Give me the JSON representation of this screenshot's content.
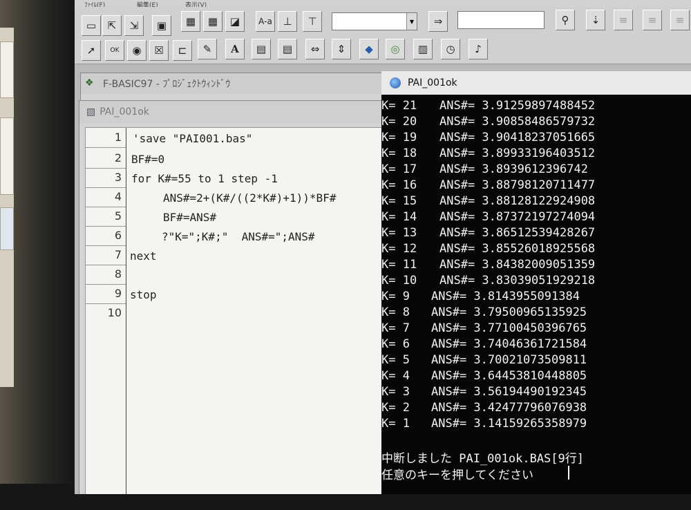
{
  "menubar": {
    "file": "ﾌｧｲﾙ(F)",
    "edit": "編集(E)",
    "view": "表示(V)"
  },
  "project_window": {
    "title": "F-BASIC97 - ﾌﾟﾛｼﾞｪｸﾄｳｨﾝﾄﾞｳ"
  },
  "editor_window": {
    "title": "PAI_001ok",
    "line_numbers": [
      "1",
      "2",
      "3",
      "4",
      "5",
      "6",
      "7",
      "8",
      "9",
      "10"
    ],
    "lines": [
      "'save \"PAI001.bas\"",
      "BF#=0",
      "for K#=55 to 1 step -1",
      "ANS#=2+(K#/((2*K#)+1))*BF#",
      "BF#=ANS#",
      "?\"K=\";K#;\"  ANS#=\";ANS#",
      "next",
      "",
      "stop",
      ""
    ]
  },
  "output_window": {
    "title": "PAI_001ok",
    "rows": [
      {
        "k": "K= 21",
        "ans": "ANS#= 3.91259897488452"
      },
      {
        "k": "K= 20",
        "ans": "ANS#= 3.90858486579732"
      },
      {
        "k": "K= 19",
        "ans": "ANS#= 3.90418237051665"
      },
      {
        "k": "K= 18",
        "ans": "ANS#= 3.89933196403512"
      },
      {
        "k": "K= 17",
        "ans": "ANS#= 3.8939612396742"
      },
      {
        "k": "K= 16",
        "ans": "ANS#= 3.88798120711477"
      },
      {
        "k": "K= 15",
        "ans": "ANS#= 3.88128122924908"
      },
      {
        "k": "K= 14",
        "ans": "ANS#= 3.87372197274094"
      },
      {
        "k": "K= 13",
        "ans": "ANS#= 3.86512539428267"
      },
      {
        "k": "K= 12",
        "ans": "ANS#= 3.85526018925568"
      },
      {
        "k": "K= 11",
        "ans": "ANS#= 3.84382009051359"
      },
      {
        "k": "K= 10",
        "ans": "ANS#= 3.83039051929218"
      },
      {
        "k": "K= 9",
        "ans": "ANS#= 3.8143955091384"
      },
      {
        "k": "K= 8",
        "ans": "ANS#= 3.79500965135925"
      },
      {
        "k": "K= 7",
        "ans": "ANS#= 3.77100450396765"
      },
      {
        "k": "K= 6",
        "ans": "ANS#= 3.74046361721584"
      },
      {
        "k": "K= 5",
        "ans": "ANS#= 3.70021073509811"
      },
      {
        "k": "K= 4",
        "ans": "ANS#= 3.64453810448805"
      },
      {
        "k": "K= 3",
        "ans": "ANS#= 3.56194490192345"
      },
      {
        "k": "K= 2",
        "ans": "ANS#= 3.42477796076938"
      },
      {
        "k": "K= 1",
        "ans": "ANS#= 3.14159265358979"
      }
    ],
    "interrupt_message": "中断しました PAI_001ok.BAS[9行]",
    "prompt_message": "任意のキーを押してください"
  },
  "icons": [
    "new-file-icon",
    "open-file-icon",
    "save-file-icon",
    "run-icon",
    "pointer-icon",
    "ok-button-icon",
    "radio-icon",
    "checkbox-icon",
    "text-tool-icon",
    "label-tool-icon",
    "font-icon",
    "image-icon",
    "timer-icon",
    "music-icon"
  ]
}
